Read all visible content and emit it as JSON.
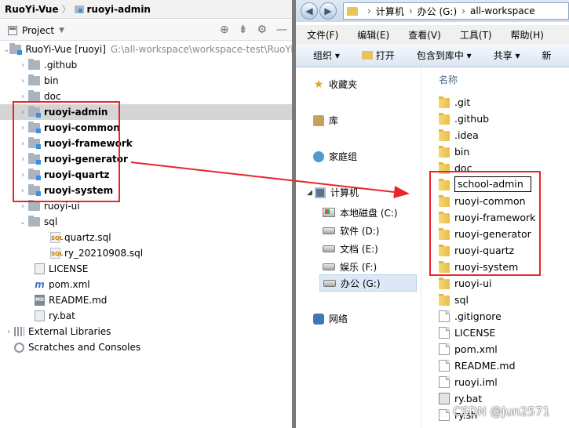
{
  "ide": {
    "breadcrumb": [
      "RuoYi-Vue",
      "ruoyi-admin"
    ],
    "panel_title": "Project",
    "project_root": {
      "name": "RuoYi-Vue [ruoyi]",
      "path": "G:\\all-workspace\\workspace-test\\RuoYi"
    },
    "tree": [
      {
        "label": ".github",
        "kind": "folder"
      },
      {
        "label": "bin",
        "kind": "folder"
      },
      {
        "label": "doc",
        "kind": "folder"
      },
      {
        "label": "ruoyi-admin",
        "kind": "module",
        "selected": true
      },
      {
        "label": "ruoyi-common",
        "kind": "module"
      },
      {
        "label": "ruoyi-framework",
        "kind": "module"
      },
      {
        "label": "ruoyi-generator",
        "kind": "module"
      },
      {
        "label": "ruoyi-quartz",
        "kind": "module"
      },
      {
        "label": "ruoyi-system",
        "kind": "module"
      },
      {
        "label": "ruoyi-ui",
        "kind": "folder"
      },
      {
        "label": "sql",
        "kind": "folder-open"
      },
      {
        "label": "quartz.sql",
        "kind": "sql"
      },
      {
        "label": "ry_20210908.sql",
        "kind": "sql"
      },
      {
        "label": "LICENSE",
        "kind": "license"
      },
      {
        "label": "pom.xml",
        "kind": "maven"
      },
      {
        "label": "README.md",
        "kind": "md"
      },
      {
        "label": "ry.bat",
        "kind": "bat"
      }
    ],
    "external_libraries": "External Libraries",
    "scratches": "Scratches and Consoles"
  },
  "explorer": {
    "address": [
      "计算机",
      "办公 (G:)",
      "all-workspace"
    ],
    "menu": [
      "文件(F)",
      "编辑(E)",
      "查看(V)",
      "工具(T)",
      "帮助(H)"
    ],
    "commands": {
      "organize": "组织 ▾",
      "open": "打开",
      "include": "包含到库中 ▾",
      "share": "共享 ▾",
      "new": "新"
    },
    "nav": {
      "favorites": "收藏夹",
      "libraries": "库",
      "homegroup": "家庭组",
      "computer": "计算机",
      "drives": [
        "本地磁盘 (C:)",
        "软件 (D:)",
        "文档 (E:)",
        "娱乐 (F:)",
        "办公 (G:)"
      ],
      "network": "网络"
    },
    "column_header": "名称",
    "files": [
      {
        "name": ".git",
        "kind": "folder"
      },
      {
        "name": ".github",
        "kind": "folder"
      },
      {
        "name": ".idea",
        "kind": "folder"
      },
      {
        "name": "bin",
        "kind": "folder"
      },
      {
        "name": "doc",
        "kind": "folder"
      },
      {
        "name": "school-admin",
        "kind": "folder",
        "renaming": true
      },
      {
        "name": "ruoyi-common",
        "kind": "folder"
      },
      {
        "name": "ruoyi-framework",
        "kind": "folder"
      },
      {
        "name": "ruoyi-generator",
        "kind": "folder"
      },
      {
        "name": "ruoyi-quartz",
        "kind": "folder"
      },
      {
        "name": "ruoyi-system",
        "kind": "folder"
      },
      {
        "name": "ruoyi-ui",
        "kind": "folder"
      },
      {
        "name": "sql",
        "kind": "folder"
      },
      {
        "name": ".gitignore",
        "kind": "file"
      },
      {
        "name": "LICENSE",
        "kind": "file"
      },
      {
        "name": "pom.xml",
        "kind": "file"
      },
      {
        "name": "README.md",
        "kind": "file"
      },
      {
        "name": "ruoyi.iml",
        "kind": "file"
      },
      {
        "name": "ry.bat",
        "kind": "bat"
      },
      {
        "name": "ry.sh",
        "kind": "file"
      }
    ]
  },
  "watermark": "CSDN @jun2571",
  "colors": {
    "highlight": "#e8252b",
    "selection": "#d5d5d5",
    "folder": "#e9bf45"
  }
}
